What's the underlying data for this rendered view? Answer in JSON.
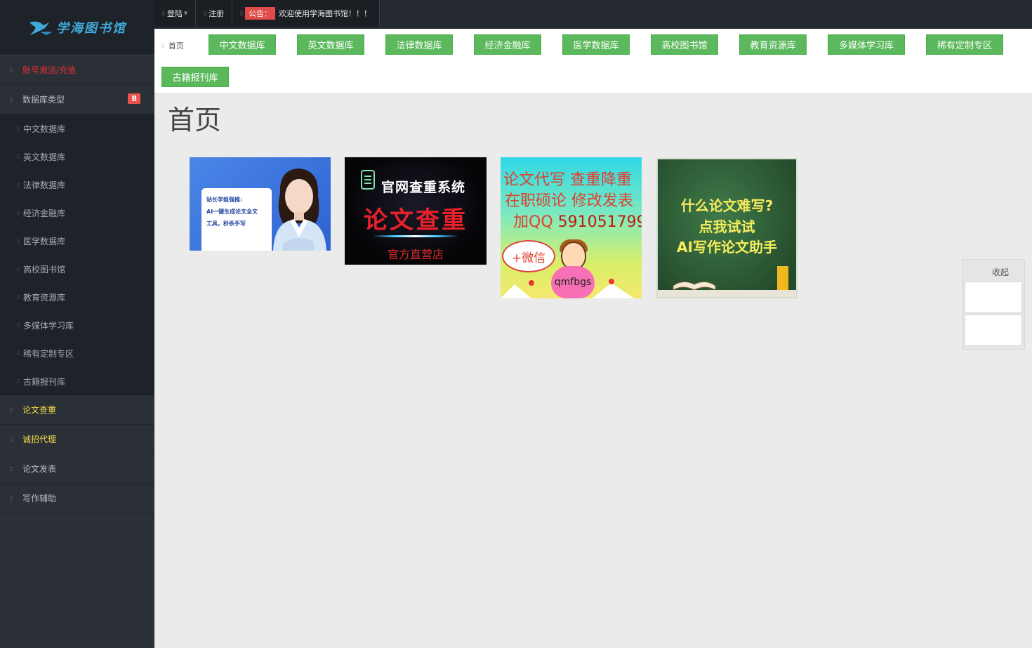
{
  "logo": {
    "text": "学海图书馆"
  },
  "sidebar": {
    "items": [
      {
        "label": "账号激活/充值",
        "style": "red"
      },
      {
        "label": "数据库类型",
        "badge": "8"
      },
      {
        "label": "论文查重",
        "style": "yellow"
      },
      {
        "label": "诚招代理",
        "style": "yellow"
      },
      {
        "label": "论文发表"
      },
      {
        "label": "写作辅助"
      }
    ],
    "submenu": [
      "中文数据库",
      "英文数据库",
      "法律数据库",
      "经济金融库",
      "医学数据库",
      "高校图书馆",
      "教育资源库",
      "多媒体学习库",
      "稀有定制专区",
      "古籍报刊库"
    ]
  },
  "topbar": {
    "login": "登陆",
    "register": "注册",
    "notice_label": "公告：",
    "notice_text": "欢迎使用学海图书馆！！！"
  },
  "breadcrumb": "首页",
  "category_buttons": [
    "中文数据库",
    "英文数据库",
    "法律数据库",
    "经济金融库",
    "医学数据库",
    "高校图书馆",
    "教育资源库",
    "多媒体学习库",
    "稀有定制专区",
    "古籍报刊库"
  ],
  "page_title": "首页",
  "ads": {
    "ad1": {
      "line1": "站长学姐强推:",
      "line2": "AI一键生成论文全文",
      "line3": "工具，秒杀手写"
    },
    "ad2": {
      "title": "官网查重系统",
      "main": "论文查重",
      "sub": "官方直营店"
    },
    "ad3": {
      "line1": "论文代写  查重降重",
      "line2": "在职硕论 修改发表",
      "line3_prefix": "加QQ",
      "line3_qq": "591051799",
      "bubble": "+微信",
      "wechat": "qmfbgs"
    },
    "ad4": {
      "line1": "什么论文难写?",
      "line2": "点我试试",
      "line3": "AI写作论文助手"
    }
  },
  "right_panel": {
    "collapse": "收起"
  },
  "colors": {
    "sidebar_bg": "#2b3037",
    "topbar_bg": "#24292f",
    "button_green": "#5cb85c",
    "badge_red": "#e8534f",
    "link_yellow": "#f0d94a",
    "link_red": "#e0302f"
  }
}
